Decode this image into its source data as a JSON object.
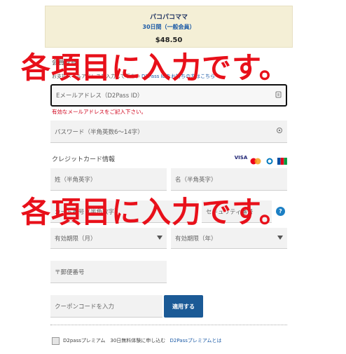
{
  "product": {
    "name": "パコパコママ",
    "plan": "30日間（一般会員）",
    "price": "$48.50"
  },
  "member_section": {
    "label": "会員登録",
    "note": "お支払メールアドレスを入力して下さい",
    "d2pass_link": "D2Pass IDをお持ちの方はこちら"
  },
  "email": {
    "placeholder": "Eメールアドレス（D2Pass ID）",
    "error": "有効なメールアドレスをご記入下さい。"
  },
  "password": {
    "placeholder": "パスワード（半角英数6〜14字）"
  },
  "card": {
    "title": "クレジットカード情報",
    "brands": [
      "VISA",
      "MC",
      "DC",
      "JCB"
    ],
    "last_name": "姓（半角英字）",
    "first_name": "名（半角英字）",
    "number": "カード番号（半角数字）",
    "security": "セキュリティ番号",
    "help": "?",
    "exp_month": "有効期限（月）",
    "exp_year": "有効期限（年）"
  },
  "postal": {
    "placeholder": "〒郵便番号"
  },
  "coupon": {
    "placeholder": "クーポンコードを入力",
    "apply": "適用する"
  },
  "premium": {
    "label": "D2passプレミアム　30日無料体験に申し込む",
    "link": "D2Passプレミアムとは"
  },
  "overlay": {
    "text1": "各項目に入力です。",
    "text2": "各項目に入力です。"
  },
  "colors": {
    "overlay": "#e8101a",
    "accent": "#1b5a96",
    "error": "#d0021b"
  }
}
